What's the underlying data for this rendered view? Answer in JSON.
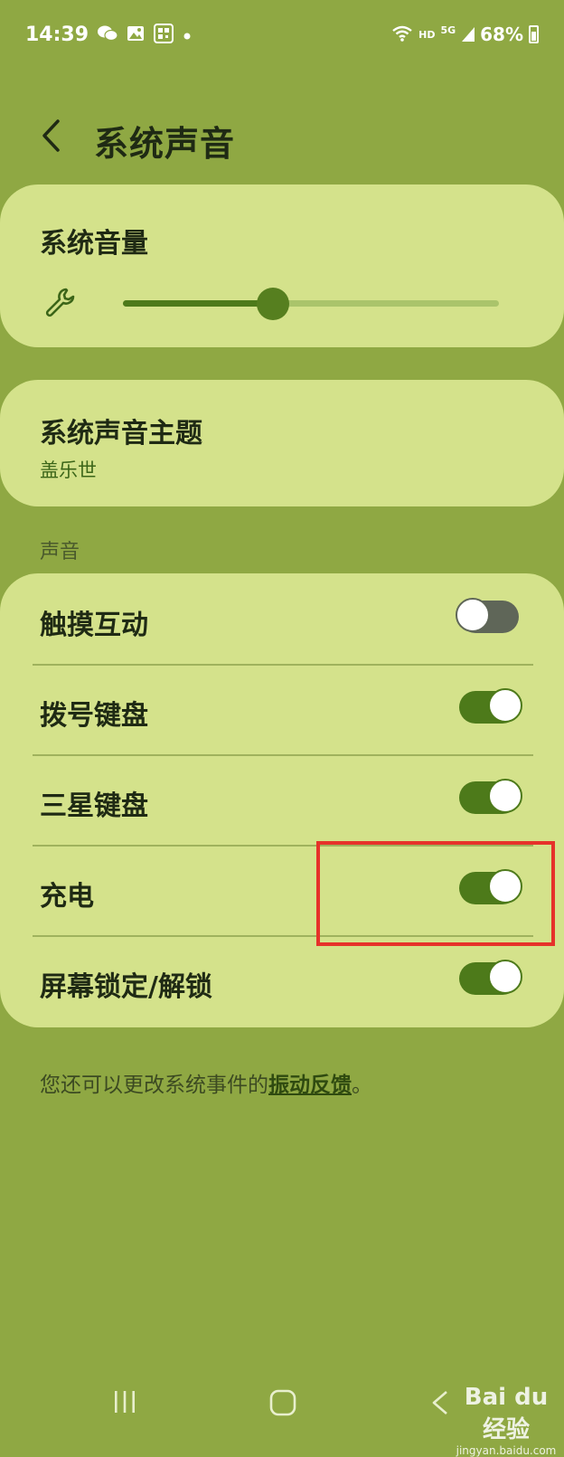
{
  "status_bar": {
    "time": "14:39",
    "left_icons": [
      "wechat-icon",
      "image-icon",
      "qr-icon",
      "dot-icon"
    ],
    "hd": "HD",
    "network": "5G",
    "battery": "68%"
  },
  "header": {
    "back_icon": "chevron-left-icon",
    "title": "系统声音"
  },
  "volume_card": {
    "title": "系统音量",
    "icon": "wrench-icon",
    "slider_value": 0.4
  },
  "theme_card": {
    "title": "系统声音主题",
    "value": "盖乐世"
  },
  "sounds_section": {
    "label": "声音",
    "items": [
      {
        "label": "触摸互动",
        "enabled": false
      },
      {
        "label": "拨号键盘",
        "enabled": true
      },
      {
        "label": "三星键盘",
        "enabled": true
      },
      {
        "label": "充电",
        "enabled": true
      },
      {
        "label": "屏幕锁定/解锁",
        "enabled": true
      }
    ]
  },
  "footer": {
    "text_before": "您还可以更改系统事件的",
    "link": "振动反馈",
    "text_after": "。"
  },
  "nav": {
    "recent_icon": "recent-apps-icon",
    "home_icon": "home-icon",
    "back_icon": "back-icon"
  },
  "watermark": {
    "logo": "Bai du 经验",
    "url": "jingyan.baidu.com"
  },
  "colors": {
    "background": "#8fa843",
    "card": "#d4e28b",
    "accent": "#4d7a1a",
    "toggle_off": "#5f6658",
    "highlight": "#e6322a"
  }
}
